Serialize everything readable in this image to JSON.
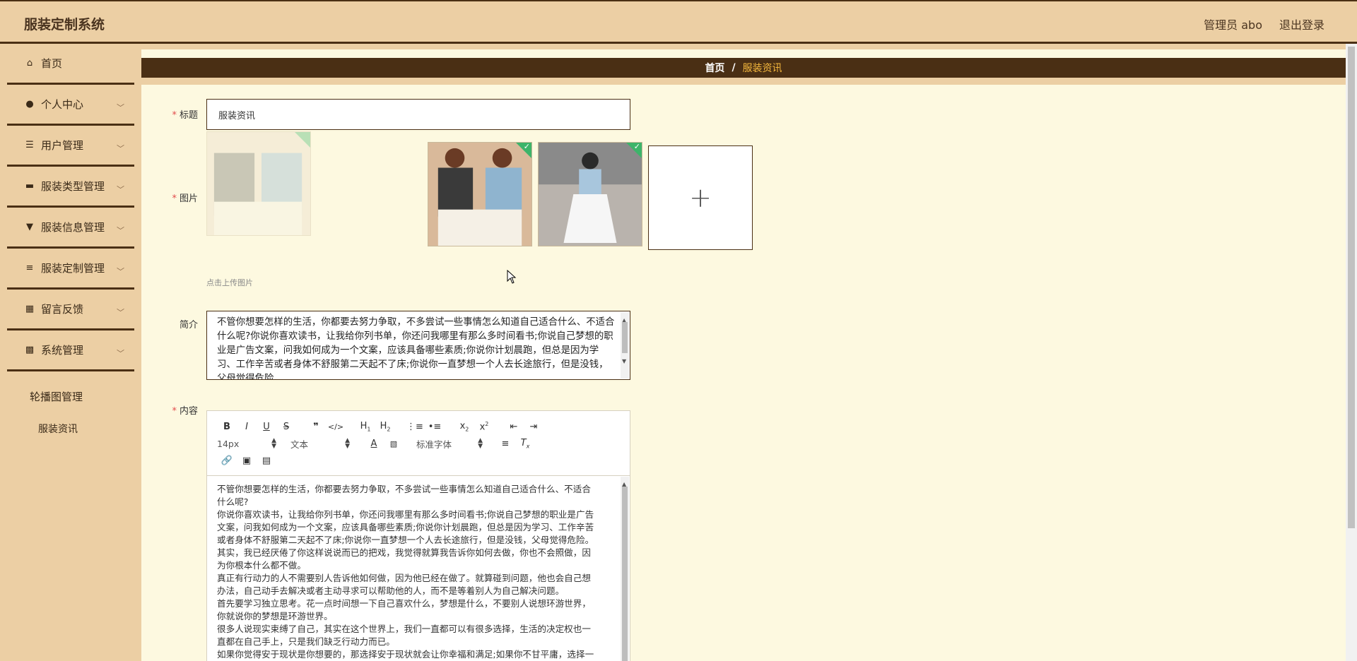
{
  "header": {
    "app_title": "服装定制系统",
    "user_label": "管理员 abo",
    "logout_label": "退出登录"
  },
  "sidebar": {
    "items": [
      {
        "label": "首页",
        "icon": "home-icon",
        "glyph": "⌂",
        "has_children": false
      },
      {
        "label": "个人中心",
        "icon": "person-icon",
        "glyph": "●",
        "has_children": true
      },
      {
        "label": "用户管理",
        "icon": "sliders-icon",
        "glyph": "☰",
        "has_children": true
      },
      {
        "label": "服装类型管理",
        "icon": "briefcase-icon",
        "glyph": "▬",
        "has_children": true
      },
      {
        "label": "服装信息管理",
        "icon": "pin-icon",
        "glyph": "▼",
        "has_children": true
      },
      {
        "label": "服装定制管理",
        "icon": "list-icon",
        "glyph": "≡",
        "has_children": true
      },
      {
        "label": "留言反馈",
        "icon": "grid-icon",
        "glyph": "▦",
        "has_children": true
      },
      {
        "label": "系统管理",
        "icon": "apps-icon",
        "glyph": "▩",
        "has_children": true
      }
    ],
    "submenu": {
      "group_label": "轮播图管理",
      "active_item": "服装资讯"
    }
  },
  "breadcrumb": {
    "home": "首页",
    "separator": "/",
    "current": "服装资讯"
  },
  "form": {
    "title_label": "标题",
    "title_value": "服装资讯",
    "image_label": "图片",
    "upload_hint": "点击上传图片",
    "upload_plus": "+",
    "intro_label": "简介",
    "intro_text": "不管你想要怎样的生活，你都要去努力争取，不多尝试一些事情怎么知道自己适合什么、不适合什么呢?你说你喜欢读书，让我给你列书单，你还问我哪里有那么多时间看书;你说自己梦想的职业是广告文案，问我如何成为一个文案，应该具备哪些素质;你说你计划晨跑，但总是因为学习、工作辛苦或者身体不舒服第二天起不了床;你说你一直梦想一个人去长途旅行，但是没钱，父母觉得危险。",
    "content_label": "内容"
  },
  "editor": {
    "font_size": "14px",
    "block_type": "文本",
    "font_family": "标准字体",
    "content_lines": [
      "不管你想要怎样的生活，你都要去努力争取，不多尝试一些事情怎么知道自己适合什么、不适合",
      "什么呢?",
      "你说你喜欢读书，让我给你列书单，你还问我哪里有那么多时间看书;你说自己梦想的职业是广告",
      "文案，问我如何成为一个文案，应该具备哪些素质;你说你计划晨跑，但总是因为学习、工作辛苦",
      "或者身体不舒服第二天起不了床;你说你一直梦想一个人去长途旅行，但是没钱，父母觉得危险。",
      "其实，我已经厌倦了你这样说说而已的把戏，我觉得就算我告诉你如何去做，你也不会照做，因",
      "为你根本什么都不做。",
      "真正有行动力的人不需要别人告诉他如何做，因为他已经在做了。就算碰到问题，他也会自己想",
      "办法，自己动手去解决或者主动寻求可以帮助他的人，而不是等着别人为自己解决问题。",
      "首先要学习独立思考。花一点时间想一下自己喜欢什么，梦想是什么，不要别人说想环游世界，",
      "你就说你的梦想是环游世界。",
      "很多人说现实束缚了自己，其实在这个世界上，我们一直都可以有很多选择，生活的决定权也一",
      "直都在自己手上，只是我们缺乏行动力而已。",
      "如果你觉得安于现状是你想要的，那选择安于现状就会让你幸福和满足;如果你不甘平庸，选择一"
    ]
  },
  "colors": {
    "header_bg": "#eccfa4",
    "dark_brown": "#4a2f14",
    "main_bg": "#fdf9e0",
    "breadcrumb_active": "#f5b83d",
    "required": "#e24b4b",
    "check_green": "#3db46a"
  }
}
